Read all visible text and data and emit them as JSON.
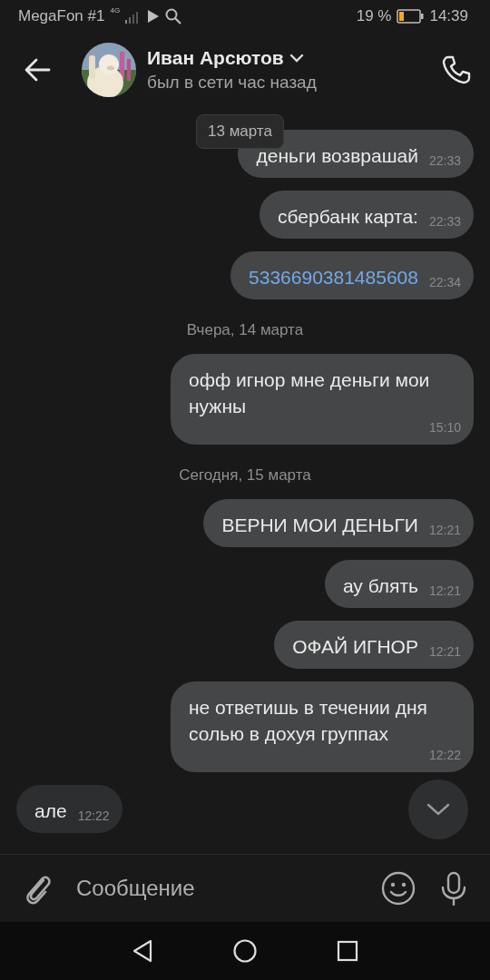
{
  "status_bar": {
    "carrier": "MegaFon #1",
    "network": "4G",
    "battery_percent": "19 %",
    "time": "14:39"
  },
  "header": {
    "name": "Иван Арсютов",
    "status": "был в сети час назад"
  },
  "floating_date": "13 марта",
  "messages": [
    {
      "kind": "outgoing",
      "text": "деньги возврашай",
      "time": "22:33",
      "link": false
    },
    {
      "kind": "outgoing",
      "text": "сбербанк карта:",
      "time": "22:33",
      "link": false
    },
    {
      "kind": "outgoing",
      "text": "5336690381485608",
      "time": "22:34",
      "link": true
    },
    {
      "kind": "date",
      "text": "Вчера, 14 марта"
    },
    {
      "kind": "outgoing",
      "text": "офф игнор мне деньги мои нужны",
      "time": "15:10",
      "link": false
    },
    {
      "kind": "date",
      "text": "Сегодня, 15 марта"
    },
    {
      "kind": "outgoing",
      "text": "ВЕРНИ МОИ ДЕНЬГИ",
      "time": "12:21",
      "link": false
    },
    {
      "kind": "outgoing",
      "text": "ау блять",
      "time": "12:21",
      "link": false
    },
    {
      "kind": "outgoing",
      "text": "ОФАЙ ИГНОР",
      "time": "12:21",
      "link": false
    },
    {
      "kind": "outgoing",
      "text": "не ответишь в течении дня солью в дохуя группах",
      "time": "12:22",
      "link": false
    },
    {
      "kind": "incoming",
      "text": "але",
      "time": "12:22",
      "link": false
    }
  ],
  "composer": {
    "placeholder": "Сообщение"
  }
}
